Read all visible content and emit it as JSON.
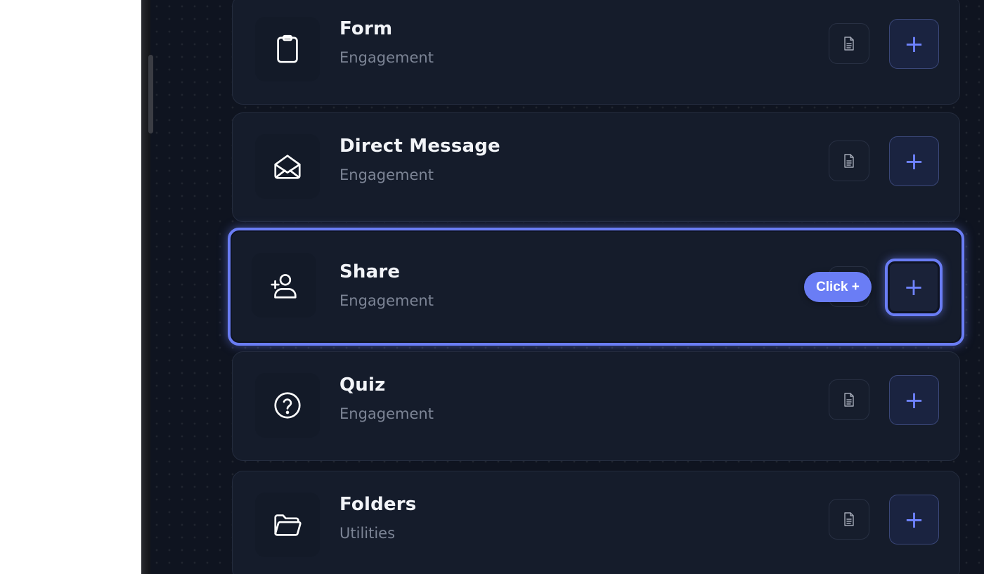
{
  "items": [
    {
      "title": "Form",
      "category": "Engagement",
      "icon": "clipboard-icon"
    },
    {
      "title": "Direct Message",
      "category": "Engagement",
      "icon": "envelope-open-icon"
    },
    {
      "title": "Share",
      "category": "Engagement",
      "icon": "user-plus-icon"
    },
    {
      "title": "Quiz",
      "category": "Engagement",
      "icon": "question-circle-icon"
    },
    {
      "title": "Folders",
      "category": "Utilities",
      "icon": "folder-open-icon"
    }
  ],
  "add_symbol": "+",
  "tooltip": {
    "label": "Click +"
  },
  "colors": {
    "panel_bg": "#0f1420",
    "card_bg": "#151c2b",
    "accent": "#6a7df5",
    "title_text": "#f2f4f8",
    "subtitle_text": "#7c8495"
  }
}
